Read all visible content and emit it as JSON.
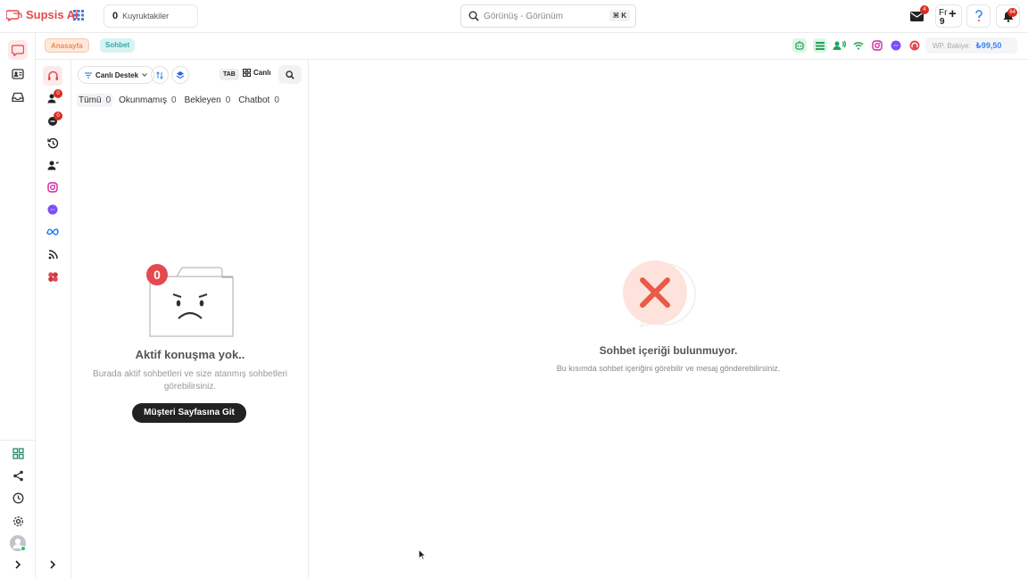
{
  "app": {
    "name": "Supsis Ai",
    "brand_color": "#e5484d"
  },
  "topbar": {
    "queue_count": "0",
    "queue_label": "Kuyruktakiler",
    "search_placeholder": "Görünüş - Görünüm",
    "search_shortcut": "⌘ K",
    "mail_badge": "4",
    "fr_label": "Fr",
    "fr_count": "9",
    "notif_badge": "64",
    "icons": [
      "grid-icon",
      "search-icon",
      "mail-icon",
      "plus-icon",
      "help-icon",
      "bell-icon"
    ]
  },
  "breadcrumb": {
    "home": "Anasayfa",
    "current": "Sohbet"
  },
  "channels": [
    "bot-icon",
    "list-icon",
    "people-icon",
    "wifi-icon",
    "instagram-icon",
    "messenger-icon",
    "chat-bubble-icon"
  ],
  "balance": {
    "label": "WP. Bakiye:",
    "amount": "₺99,50"
  },
  "left_nav": [
    "chat-icon",
    "contacts-icon",
    "inbox-icon"
  ],
  "left_nav_bottom": [
    "dashboard-icon",
    "share-icon",
    "clock-icon",
    "settings-icon",
    "avatar"
  ],
  "sub_nav": {
    "items": [
      "live-support-icon",
      "assigned-users-icon",
      "missed-chat-icon",
      "history-icon",
      "team-icon",
      "instagram-icon",
      "messenger-icon",
      "meta-icon",
      "feed-icon",
      "integration-icon"
    ],
    "badges": {
      "assigned": "0",
      "missed": "0"
    }
  },
  "list": {
    "filter_label": "Canlı Destek",
    "tab_key": "TAB",
    "live_label": "Canlı",
    "tabs": [
      {
        "label": "Tümü",
        "count": "0"
      },
      {
        "label": "Okunmamış",
        "count": "0"
      },
      {
        "label": "Bekleyen",
        "count": "0"
      },
      {
        "label": "Chatbot",
        "count": "0"
      }
    ],
    "empty": {
      "badge": "0",
      "title": "Aktif konuşma yok..",
      "description": "Burada aktif sohbetleri ve size atanmış sohbetleri görebilirsiniz.",
      "cta": "Müşteri Sayfasına Git"
    }
  },
  "main": {
    "empty_title": "Sohbet içeriği bulunmuyor.",
    "empty_description": "Bu kısımda sohbet içeriğini görebilir ve mesaj gönderebilirsiniz."
  }
}
